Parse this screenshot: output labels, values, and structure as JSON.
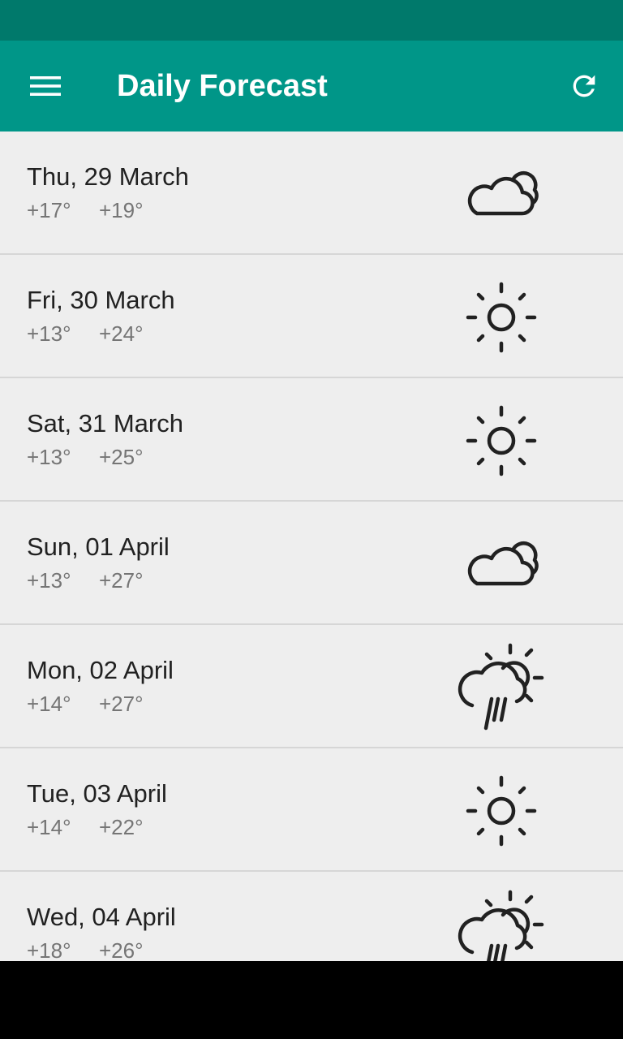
{
  "app_bar": {
    "title": "Daily Forecast",
    "menu_icon": "hamburger-menu-icon",
    "refresh_icon": "refresh-icon"
  },
  "colors": {
    "status_bar": "#00796B",
    "app_bar": "#009688",
    "list_background": "#EEEEEE",
    "primary_text": "#212121",
    "secondary_text": "#757575",
    "icon_color": "#212121"
  },
  "forecast": [
    {
      "date": "Thu, 29 March",
      "low": "+17°",
      "high": "+19°",
      "icon": "cloudy-icon"
    },
    {
      "date": "Fri, 30 March",
      "low": "+13°",
      "high": "+24°",
      "icon": "sunny-icon"
    },
    {
      "date": "Sat, 31 March",
      "low": "+13°",
      "high": "+25°",
      "icon": "sunny-icon"
    },
    {
      "date": "Sun, 01 April",
      "low": "+13°",
      "high": "+27°",
      "icon": "cloudy-icon"
    },
    {
      "date": "Mon, 02 April",
      "low": "+14°",
      "high": "+27°",
      "icon": "sun-rain-icon"
    },
    {
      "date": "Tue, 03 April",
      "low": "+14°",
      "high": "+22°",
      "icon": "sunny-icon"
    },
    {
      "date": "Wed, 04 April",
      "low": "+18°",
      "high": "+26°",
      "icon": "sun-rain-icon"
    }
  ]
}
